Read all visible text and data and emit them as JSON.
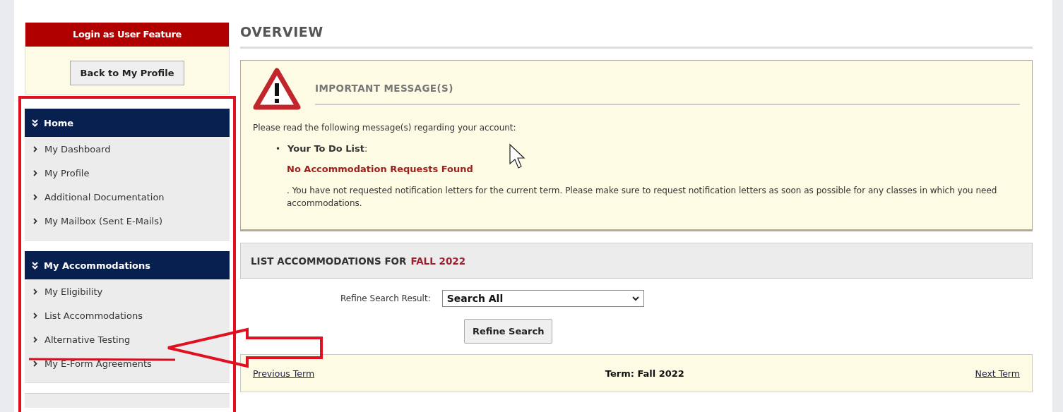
{
  "sidebar": {
    "login_panel": {
      "title": "Login as User Feature",
      "button": "Back to My Profile"
    },
    "sections": [
      {
        "title": "Home",
        "expanded": true,
        "items": [
          {
            "label": "My Dashboard"
          },
          {
            "label": "My Profile"
          },
          {
            "label": "Additional Documentation"
          },
          {
            "label": "My Mailbox (Sent E-Mails)"
          }
        ]
      },
      {
        "title": "My Accommodations",
        "expanded": true,
        "items": [
          {
            "label": "My Eligibility"
          },
          {
            "label": "List Accommodations"
          },
          {
            "label": "Alternative Testing"
          },
          {
            "label": "My E-Form Agreements"
          }
        ]
      }
    ]
  },
  "main": {
    "title": "OVERVIEW",
    "message": {
      "heading": "IMPORTANT MESSAGE(S)",
      "intro": "Please read the following message(s) regarding your account:",
      "bullet_marker": "•",
      "bullet": "**Your To Do List**:",
      "status": "No Accommodation Requests Found",
      "note": ". You have not requested notification letters for the current term. Please make sure to request notification letters as soon as possible for any classes in which you need accommodations."
    },
    "accommodations": {
      "heading": "LIST ACCOMMODATIONS FOR",
      "term_highlight": "FALL 2022",
      "filter_label": "Refine Search Result:",
      "filter_value": "Search All",
      "button": "Refine Search"
    },
    "term_bar": {
      "previous": "Previous Term",
      "term": "Term: Fall 2022",
      "next": "Next Term"
    }
  }
}
